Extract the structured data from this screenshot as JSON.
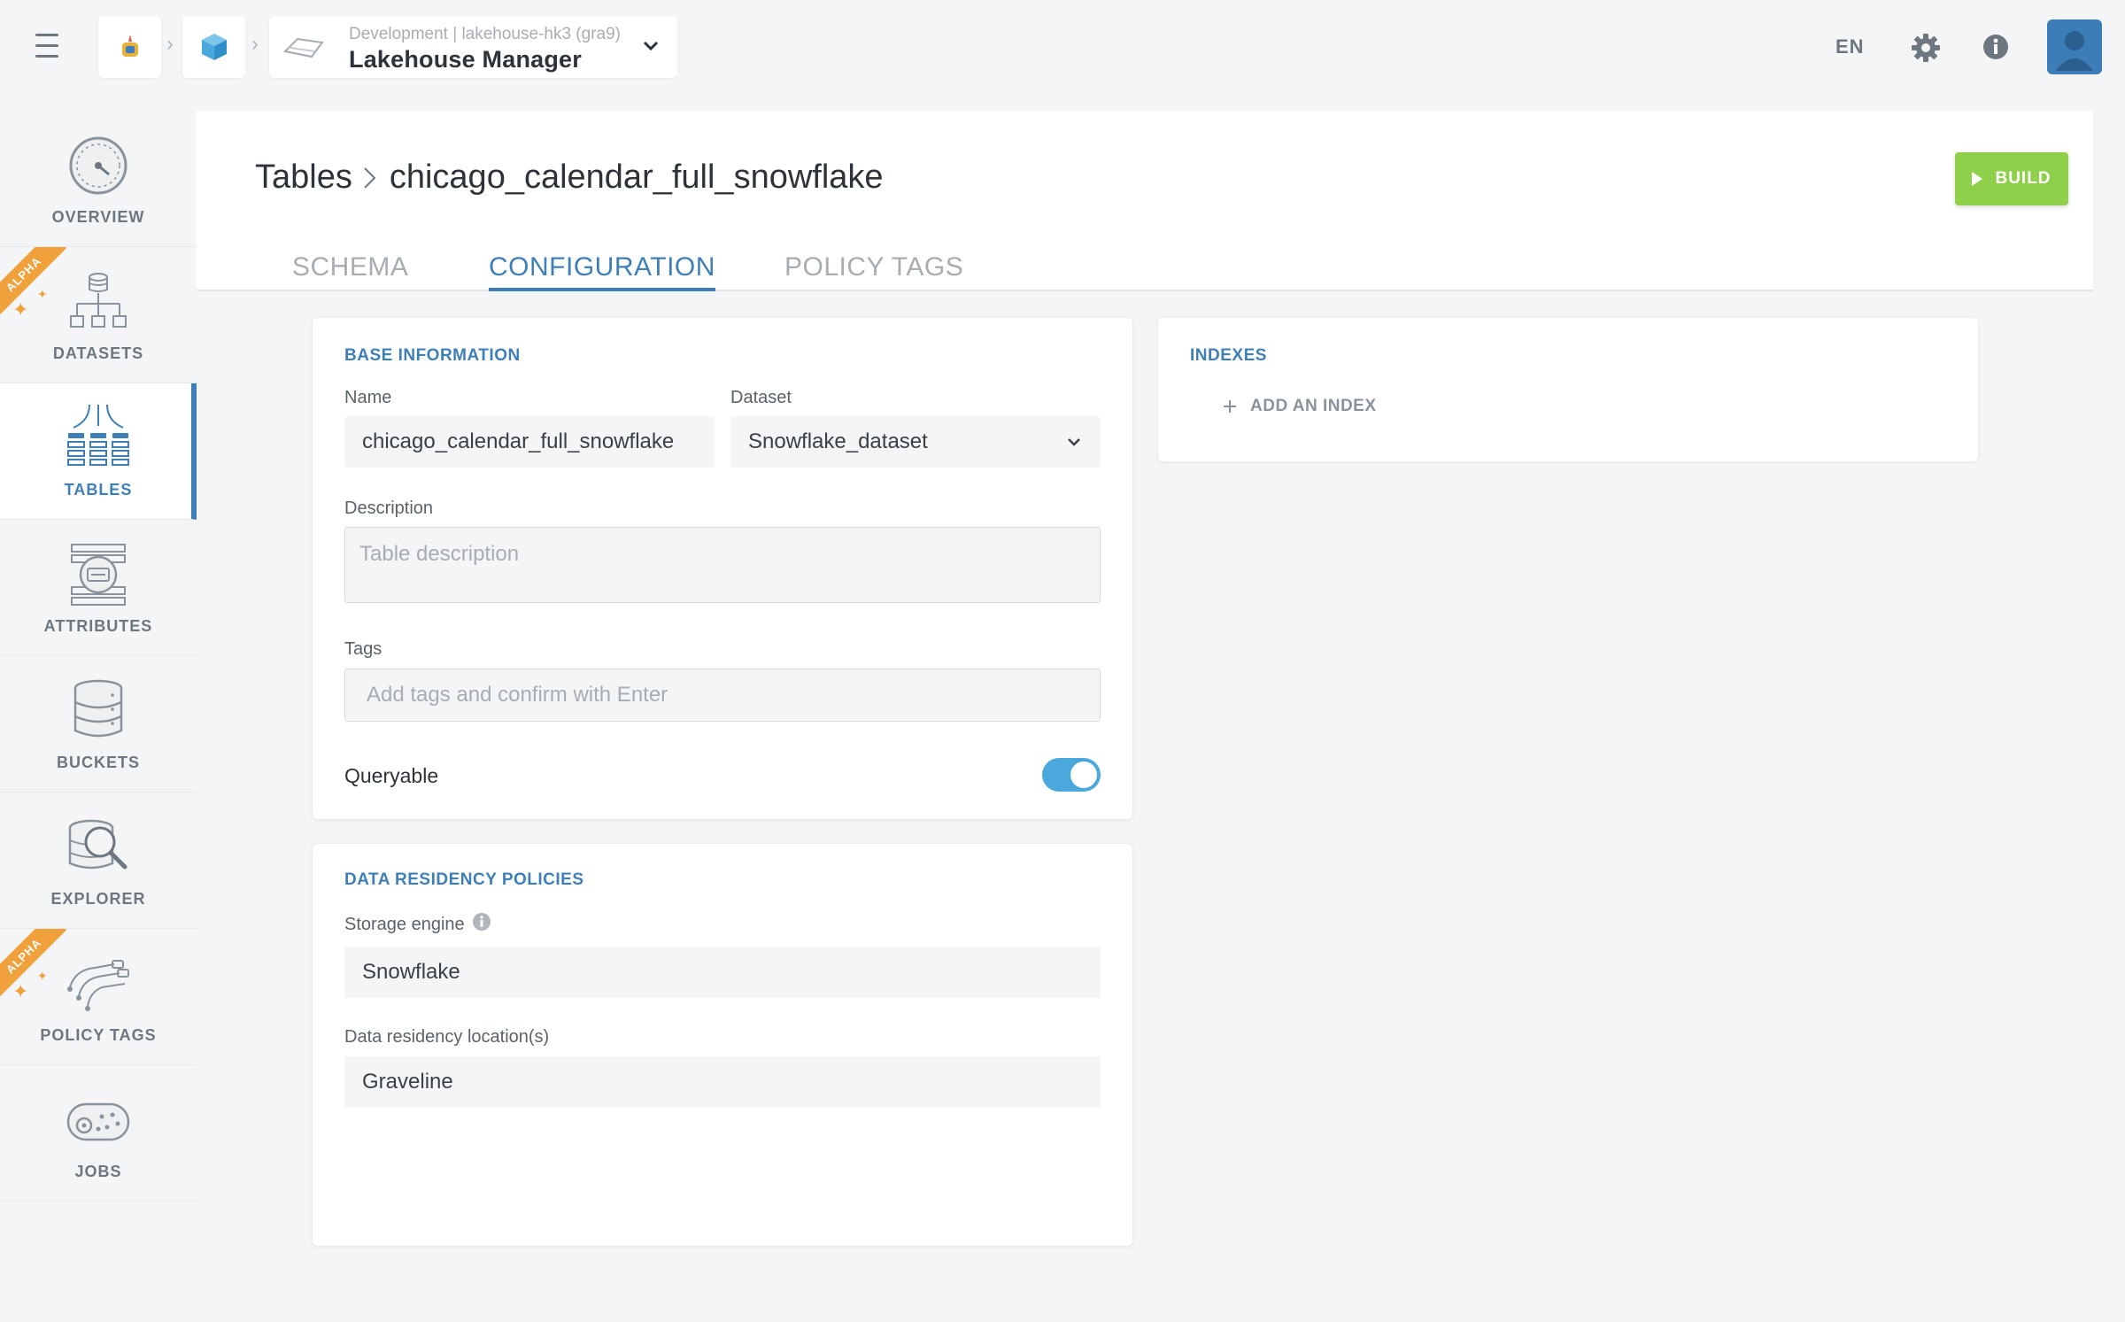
{
  "topbar": {
    "env_label": "Development | lakehouse-hk3 (gra9)",
    "app_name": "Lakehouse Manager",
    "language": "EN"
  },
  "sidebar": {
    "items": [
      {
        "label": "OVERVIEW",
        "icon": "speedometer-icon",
        "alpha": false,
        "active": false
      },
      {
        "label": "DATASETS",
        "icon": "dataset-tree-icon",
        "alpha": true,
        "active": false
      },
      {
        "label": "TABLES",
        "icon": "tables-icon",
        "alpha": false,
        "active": true
      },
      {
        "label": "ATTRIBUTES",
        "icon": "attributes-icon",
        "alpha": false,
        "active": false
      },
      {
        "label": "BUCKETS",
        "icon": "database-bucket-icon",
        "alpha": false,
        "active": false
      },
      {
        "label": "EXPLORER",
        "icon": "magnifier-database-icon",
        "alpha": false,
        "active": false
      },
      {
        "label": "POLICY TAGS",
        "icon": "policy-tags-icon",
        "alpha": true,
        "active": false
      },
      {
        "label": "JOBS",
        "icon": "jobs-conveyor-icon",
        "alpha": false,
        "active": false
      }
    ],
    "alpha_label": "ALPHA"
  },
  "page": {
    "breadcrumb_root": "Tables",
    "breadcrumb_current": "chicago_calendar_full_snowflake",
    "build_label": "BUILD",
    "tabs": [
      "SCHEMA",
      "CONFIGURATION",
      "POLICY TAGS"
    ],
    "active_tab": "CONFIGURATION"
  },
  "base_info": {
    "title": "BASE INFORMATION",
    "name_label": "Name",
    "name_value": "chicago_calendar_full_snowflake",
    "dataset_label": "Dataset",
    "dataset_value": "Snowflake_dataset",
    "description_label": "Description",
    "description_placeholder": "Table description",
    "tags_label": "Tags",
    "tags_placeholder": "Add tags and confirm with Enter",
    "queryable_label": "Queryable",
    "queryable_on": true
  },
  "residency": {
    "title": "DATA RESIDENCY POLICIES",
    "engine_label": "Storage engine",
    "engine_value": "Snowflake",
    "location_label": "Data residency location(s)",
    "location_value": "Graveline"
  },
  "indexes": {
    "title": "INDEXES",
    "add_label": "ADD AN INDEX"
  },
  "colors": {
    "accent": "#3f7fb8",
    "build": "#8ed04a",
    "toggle": "#4aa8dc",
    "alpha": "#f0a13c"
  }
}
